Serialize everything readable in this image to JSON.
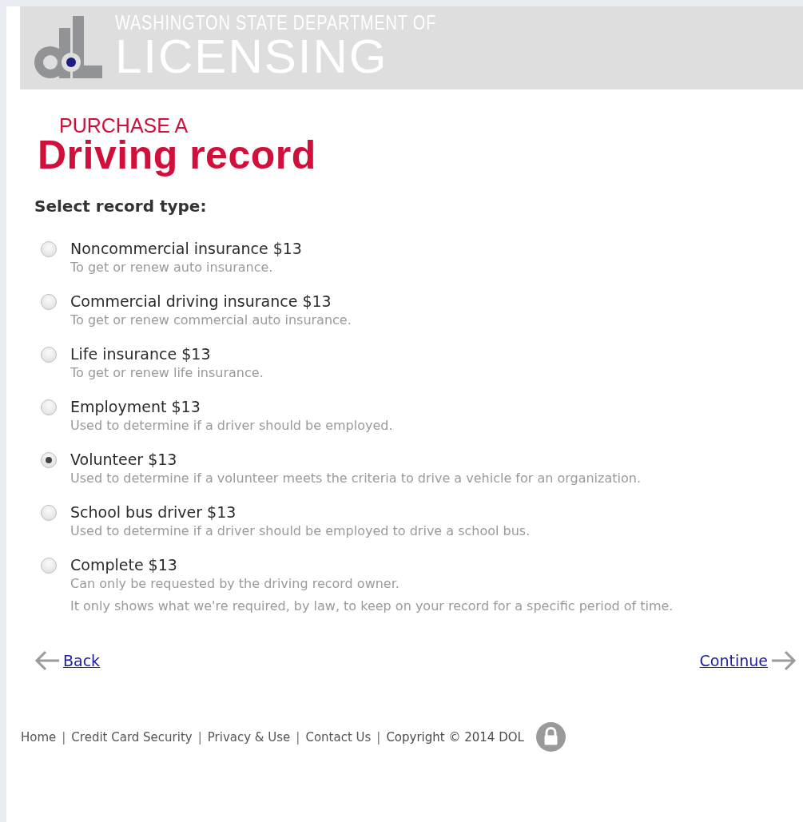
{
  "header": {
    "agency_line": "WASHINGTON STATE DEPARTMENT OF",
    "agency_name": "LICENSING"
  },
  "heading": {
    "kicker": "PURCHASE A",
    "title": "Driving record"
  },
  "prompt": "Select record type:",
  "options": [
    {
      "label": "Noncommercial insurance $13",
      "descriptions": [
        "To get or renew auto insurance."
      ],
      "selected": false
    },
    {
      "label": "Commercial driving insurance $13",
      "descriptions": [
        "To get or renew commercial auto insurance."
      ],
      "selected": false
    },
    {
      "label": "Life insurance $13",
      "descriptions": [
        "To get or renew life insurance."
      ],
      "selected": false
    },
    {
      "label": "Employment $13",
      "descriptions": [
        "Used to determine if a driver should be employed."
      ],
      "selected": false
    },
    {
      "label": "Volunteer $13",
      "descriptions": [
        "Used to determine if a volunteer meets the criteria to drive a vehicle for an organization."
      ],
      "selected": true
    },
    {
      "label": "School bus driver $13",
      "descriptions": [
        "Used to determine if a driver should be employed to drive a school bus."
      ],
      "selected": false
    },
    {
      "label": "Complete $13",
      "descriptions": [
        "Can only be requested by the driving record owner.",
        "It only shows what we're required, by law, to keep on your record for a specific period of time."
      ],
      "selected": false
    }
  ],
  "nav": {
    "back": "Back",
    "continue": "Continue"
  },
  "footer": [
    {
      "kind": "link",
      "text": "Home"
    },
    {
      "kind": "separator",
      "text": "|"
    },
    {
      "kind": "link",
      "text": "Credit Card Security"
    },
    {
      "kind": "separator",
      "text": "|"
    },
    {
      "kind": "link",
      "text": "Privacy & Use"
    },
    {
      "kind": "separator",
      "text": "|"
    },
    {
      "kind": "link",
      "text": "Contact Us"
    },
    {
      "kind": "separator",
      "text": "|"
    },
    {
      "kind": "text",
      "text": "Copyright © 2014 DOL"
    }
  ]
}
